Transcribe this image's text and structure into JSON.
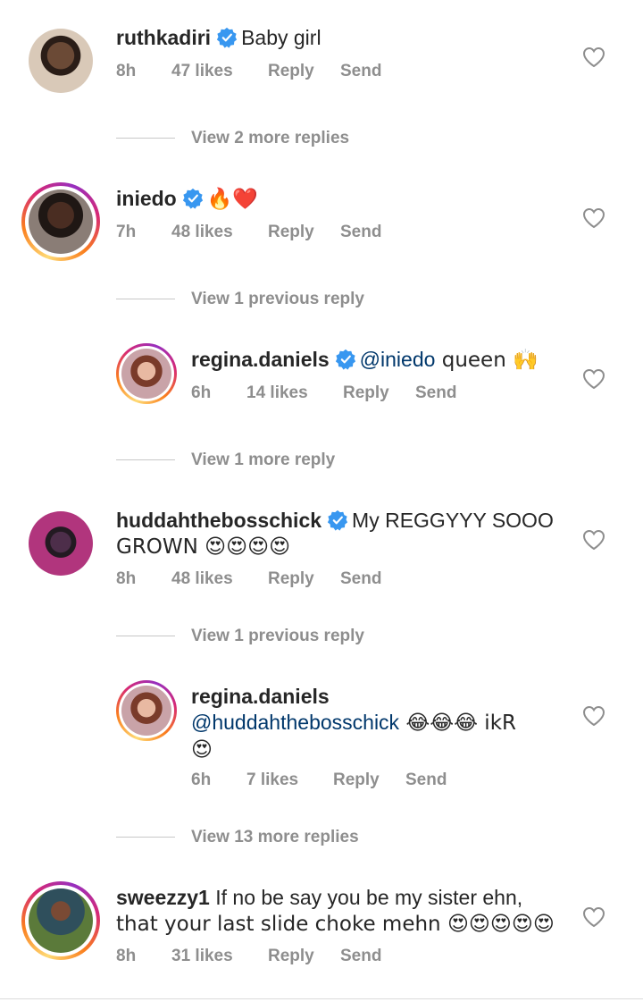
{
  "comments": [
    {
      "username": "ruthkadiri",
      "verified": true,
      "text": "Baby girl",
      "time": "8h",
      "likes": "47 likes",
      "reply": "Reply",
      "send": "Send"
    },
    {
      "username": "iniedo",
      "verified": true,
      "text": "🔥❤️",
      "time": "7h",
      "likes": "48 likes",
      "reply": "Reply",
      "send": "Send"
    },
    {
      "username": "regina.daniels",
      "verified": true,
      "mention": "@iniedo",
      "text": " queen 🙌",
      "time": "6h",
      "likes": "14 likes",
      "reply": "Reply",
      "send": "Send"
    },
    {
      "username": "huddahthebosschick",
      "verified": true,
      "text_line1": "My REGGYYY SOOO",
      "text_line2": "GROWN 😍😍😍😍",
      "time": "8h",
      "likes": "48 likes",
      "reply": "Reply",
      "send": "Send"
    },
    {
      "username": "regina.daniels",
      "verified": false,
      "mention": "@huddahthebosschick",
      "text_line1": " 😂😂😂 ikR",
      "text_line2": "😍",
      "time": "6h",
      "likes": "7 likes",
      "reply": "Reply",
      "send": "Send"
    },
    {
      "username": "sweezzy1",
      "verified": false,
      "text_line1": " If no be say you be my sister ehn,",
      "text_line2": "that your last slide choke mehn 😍😍😍😍😍",
      "time": "8h",
      "likes": "31 likes",
      "reply": "Reply",
      "send": "Send"
    }
  ],
  "view_replies": [
    "View 2 more replies",
    "View 1 previous reply",
    "View 1 more reply",
    "View 1 previous reply",
    "View 13 more replies"
  ],
  "colors": {
    "verified_blue": "#3897f0",
    "meta_gray": "#8e8e8e",
    "mention_blue": "#00376b"
  }
}
